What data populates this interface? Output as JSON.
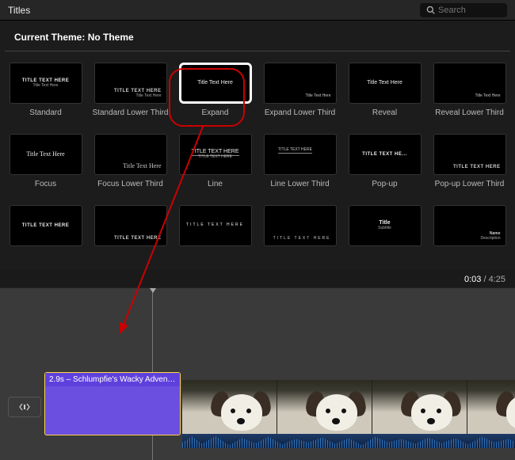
{
  "header": {
    "title": "Titles"
  },
  "search": {
    "placeholder": "Search"
  },
  "theme": {
    "label": "Current Theme:",
    "value": "No Theme"
  },
  "tiles": [
    {
      "label": "Standard",
      "preview": "TITLE TEXT HERE",
      "sub": "Title Text Here",
      "style": "boldcaps-center"
    },
    {
      "label": "Standard Lower Third",
      "preview": "TITLE TEXT HERE",
      "sub": "Title Text Here",
      "style": "boldcaps-lower"
    },
    {
      "label": "Expand",
      "preview": "Title Text Here",
      "style": "plain-center",
      "selected": true
    },
    {
      "label": "Expand Lower Third",
      "preview": "Title Text Here",
      "style": "plain-lower"
    },
    {
      "label": "Reveal",
      "preview": "Title Text Here",
      "style": "plain-center"
    },
    {
      "label": "Reveal Lower Third",
      "preview": "Title Text Here",
      "style": "plain-lower"
    },
    {
      "label": "Focus",
      "preview": "Title Text Here",
      "style": "serif-center"
    },
    {
      "label": "Focus Lower Third",
      "preview": "Title Text Here",
      "style": "serif-lower"
    },
    {
      "label": "Line",
      "preview": "TITLE TEXT HERE",
      "sub": "TITLE TEXT HERE",
      "style": "line-center"
    },
    {
      "label": "Line Lower Third",
      "preview": "TITLE TEXT HERE",
      "style": "line-lower"
    },
    {
      "label": "Pop-up",
      "preview": "TITLE TEXT HE...",
      "style": "boldcaps-center"
    },
    {
      "label": "Pop-up Lower Third",
      "preview": "TITLE TEXT HERE",
      "style": "boldcaps-lower"
    },
    {
      "label": "",
      "preview": "TITLE TEXT HERE",
      "style": "boldcaps-center"
    },
    {
      "label": "",
      "preview": "TITLE TEXT HERE",
      "style": "boldcaps-lower"
    },
    {
      "label": "",
      "preview": "TITLE TEXT HERE",
      "style": "spaced-center"
    },
    {
      "label": "",
      "preview": "TITLE TEXT HERE",
      "style": "spaced-lower"
    },
    {
      "label": "",
      "preview": "Title",
      "sub": "Subtitle",
      "style": "title-sub-center"
    },
    {
      "label": "",
      "preview": "Name",
      "sub": "Description",
      "style": "title-sub-lower"
    }
  ],
  "time": {
    "current": "0:03",
    "total": "4:25"
  },
  "clip": {
    "label": "2.9s – Schlumpfie's Wacky Advent..."
  }
}
